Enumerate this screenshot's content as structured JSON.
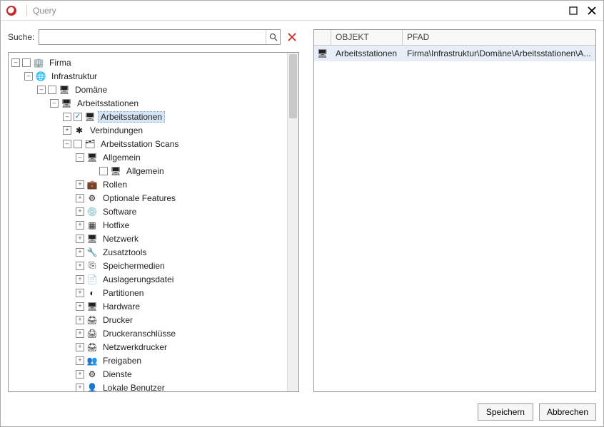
{
  "window": {
    "title": "Query"
  },
  "search": {
    "label": "Suche:",
    "placeholder": "",
    "value": ""
  },
  "tree": [
    {
      "level": 0,
      "expand": "minus",
      "checkbox": "empty",
      "icon": "company",
      "label": "Firma",
      "selected": false
    },
    {
      "level": 1,
      "expand": "minus",
      "checkbox": null,
      "icon": "globe",
      "label": "Infrastruktur",
      "selected": false
    },
    {
      "level": 2,
      "expand": "minus",
      "checkbox": "empty",
      "icon": "domain",
      "label": "Domäne",
      "selected": false
    },
    {
      "level": 3,
      "expand": "minus",
      "checkbox": null,
      "icon": "ws",
      "label": "Arbeitsstationen",
      "selected": false
    },
    {
      "level": 4,
      "expand": "minus",
      "checkbox": "checked",
      "icon": "ws",
      "label": "Arbeitsstationen",
      "selected": true
    },
    {
      "level": 4,
      "expand": "plus",
      "checkbox": null,
      "icon": "conn",
      "label": "Verbindungen",
      "selected": false
    },
    {
      "level": 4,
      "expand": "minus",
      "checkbox": "empty",
      "icon": "scan",
      "label": "Arbeitsstation Scans",
      "selected": false
    },
    {
      "level": 5,
      "expand": "minus",
      "checkbox": null,
      "icon": "ws",
      "label": "Allgemein",
      "selected": false
    },
    {
      "level": 6,
      "expand": "blank",
      "checkbox": "empty",
      "icon": "ws",
      "label": "Allgemein",
      "selected": false
    },
    {
      "level": 5,
      "expand": "plus",
      "checkbox": null,
      "icon": "roles",
      "label": "Rollen",
      "selected": false
    },
    {
      "level": 5,
      "expand": "plus",
      "checkbox": null,
      "icon": "feat",
      "label": "Optionale Features",
      "selected": false
    },
    {
      "level": 5,
      "expand": "plus",
      "checkbox": null,
      "icon": "sw",
      "label": "Software",
      "selected": false
    },
    {
      "level": 5,
      "expand": "plus",
      "checkbox": null,
      "icon": "hotfix",
      "label": "Hotfixe",
      "selected": false
    },
    {
      "level": 5,
      "expand": "plus",
      "checkbox": null,
      "icon": "net",
      "label": "Netzwerk",
      "selected": false
    },
    {
      "level": 5,
      "expand": "plus",
      "checkbox": null,
      "icon": "tool",
      "label": "Zusatztools",
      "selected": false
    },
    {
      "level": 5,
      "expand": "plus",
      "checkbox": null,
      "icon": "usb",
      "label": "Speichermedien",
      "selected": false
    },
    {
      "level": 5,
      "expand": "plus",
      "checkbox": null,
      "icon": "page",
      "label": "Auslagerungsdatei",
      "selected": false
    },
    {
      "level": 5,
      "expand": "plus",
      "checkbox": null,
      "icon": "part",
      "label": "Partitionen",
      "selected": false
    },
    {
      "level": 5,
      "expand": "plus",
      "checkbox": null,
      "icon": "hw",
      "label": "Hardware",
      "selected": false
    },
    {
      "level": 5,
      "expand": "plus",
      "checkbox": null,
      "icon": "print",
      "label": "Drucker",
      "selected": false
    },
    {
      "level": 5,
      "expand": "plus",
      "checkbox": null,
      "icon": "print",
      "label": "Druckeranschlüsse",
      "selected": false
    },
    {
      "level": 5,
      "expand": "plus",
      "checkbox": null,
      "icon": "print",
      "label": "Netzwerkdrucker",
      "selected": false
    },
    {
      "level": 5,
      "expand": "plus",
      "checkbox": null,
      "icon": "share",
      "label": "Freigaben",
      "selected": false
    },
    {
      "level": 5,
      "expand": "plus",
      "checkbox": null,
      "icon": "svc",
      "label": "Dienste",
      "selected": false
    },
    {
      "level": 5,
      "expand": "plus",
      "checkbox": null,
      "icon": "user",
      "label": "Lokale Benutzer",
      "selected": false
    }
  ],
  "grid": {
    "columns": [
      "OBJEKT",
      "PFAD"
    ],
    "rows": [
      {
        "icon": "ws",
        "object": "Arbeitsstationen",
        "path": "Firma\\Infrastruktur\\Domäne\\Arbeitsstationen\\A..."
      }
    ]
  },
  "footer": {
    "save": "Speichern",
    "cancel": "Abbrechen"
  },
  "icons": {
    "company": "🏢",
    "globe": "🌐",
    "domain": "🖥",
    "ws": "🖥",
    "conn": "✱",
    "scan": "🗂",
    "roles": "💼",
    "feat": "⚙",
    "sw": "💿",
    "hotfix": "▦",
    "net": "🖥",
    "tool": "🔧",
    "usb": "⎘",
    "page": "📄",
    "part": "◐",
    "hw": "🖥",
    "print": "🖨",
    "share": "👥",
    "svc": "⚙",
    "user": "👤"
  }
}
